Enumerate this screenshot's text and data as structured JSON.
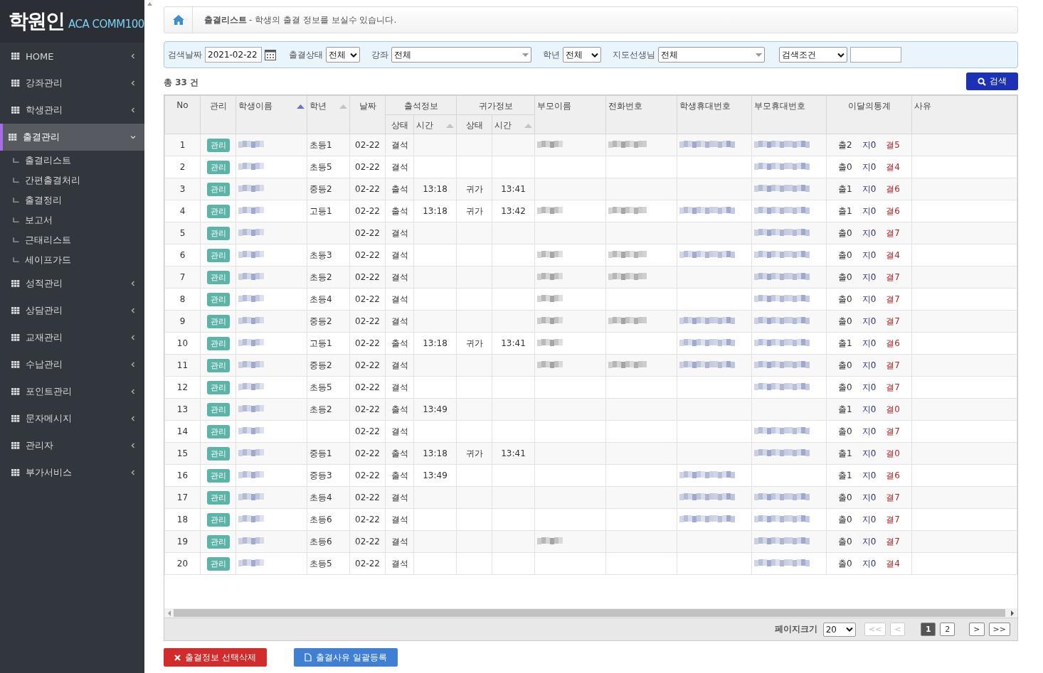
{
  "logo": {
    "mark": "학원인",
    "product": "ACA COMM100"
  },
  "sidebar": {
    "items": [
      {
        "label": "HOME",
        "expanded": false,
        "selected": false
      },
      {
        "label": "강좌관리",
        "expanded": false,
        "selected": false
      },
      {
        "label": "학생관리",
        "expanded": false,
        "selected": false
      },
      {
        "label": "출결관리",
        "expanded": true,
        "selected": true,
        "children": [
          {
            "marker": "ㄴ",
            "label": "출결리스트"
          },
          {
            "marker": "ㄴ",
            "label": "간편출결처리"
          },
          {
            "marker": "ㄴ",
            "label": "출결정리"
          },
          {
            "marker": "ㄴ",
            "label": "보고서"
          },
          {
            "marker": "ㄴ",
            "label": "근태리스트"
          },
          {
            "marker": "ㄴ",
            "label": "세이프가드"
          }
        ]
      },
      {
        "label": "성적관리",
        "expanded": false,
        "selected": false
      },
      {
        "label": "상담관리",
        "expanded": false,
        "selected": false
      },
      {
        "label": "교재관리",
        "expanded": false,
        "selected": false
      },
      {
        "label": "수납관리",
        "expanded": false,
        "selected": false
      },
      {
        "label": "포인트관리",
        "expanded": false,
        "selected": false
      },
      {
        "label": "문자메시지",
        "expanded": false,
        "selected": false
      },
      {
        "label": "관리자",
        "expanded": false,
        "selected": false
      },
      {
        "label": "부가서비스",
        "expanded": false,
        "selected": false
      }
    ]
  },
  "breadcrumb": {
    "title": "출결리스트",
    "description": "- 학생의 출결 정보를 보실수 있습니다."
  },
  "filters": {
    "date_label": "검색날짜",
    "date": "2021-02-22",
    "status_label": "출결상태",
    "status": "전체",
    "course_label": "강좌",
    "course": "전체",
    "grade_label": "학년",
    "grade": "전체",
    "teacher_label": "지도선생님",
    "teacher": "전체",
    "condition": "검색조건",
    "search_button": "검색"
  },
  "total": "총 33 건",
  "table": {
    "columns": [
      {
        "label": "No",
        "sortable": false
      },
      {
        "label": "관리",
        "sortable": false
      },
      {
        "label": "학생이름",
        "sortable": true,
        "sorted": true
      },
      {
        "label": "학년",
        "sortable": true,
        "sorted": false
      },
      {
        "label": "날짜",
        "sortable": false
      },
      {
        "label": "출석정보",
        "sub": [
          {
            "label": "상태",
            "sortable": false
          },
          {
            "label": "시간",
            "sortable": true,
            "sorted": false
          }
        ]
      },
      {
        "label": "귀가정보",
        "sub": [
          {
            "label": "상태",
            "sortable": false
          },
          {
            "label": "시간",
            "sortable": true,
            "sorted": false
          }
        ]
      },
      {
        "label": "부모이름",
        "sortable": false
      },
      {
        "label": "전화번호",
        "sortable": false
      },
      {
        "label": "학생휴대번호",
        "sortable": false
      },
      {
        "label": "부모휴대번호",
        "sortable": false
      },
      {
        "label": "이달의통계",
        "sortable": false
      },
      {
        "label": "사유",
        "sortable": false
      }
    ],
    "rows": [
      {
        "no": "1",
        "manage": "관리",
        "grade": "초등1",
        "date": "02-22",
        "status": "결석",
        "in_time": "",
        "home_status": "",
        "home_time": "",
        "blurred": {
          "name": true,
          "parent_name": true,
          "phone": true,
          "student_phone": true,
          "parent_phone": true
        },
        "stats": [
          "출2",
          "지0",
          "결5"
        ]
      },
      {
        "no": "2",
        "manage": "관리",
        "grade": "초등5",
        "date": "02-22",
        "status": "결석",
        "in_time": "",
        "home_status": "",
        "home_time": "",
        "blurred": {
          "name": true,
          "parent_name": false,
          "phone": false,
          "student_phone": false,
          "parent_phone": true
        },
        "stats": [
          "출0",
          "지0",
          "결4"
        ]
      },
      {
        "no": "3",
        "manage": "관리",
        "grade": "중등2",
        "date": "02-22",
        "status": "출석",
        "in_time": "13:18",
        "home_status": "귀가",
        "home_time": "13:41",
        "blurred": {
          "name": true,
          "parent_name": false,
          "phone": false,
          "student_phone": false,
          "parent_phone": true
        },
        "stats": [
          "출1",
          "지0",
          "결6"
        ]
      },
      {
        "no": "4",
        "manage": "관리",
        "grade": "고등1",
        "date": "02-22",
        "status": "출석",
        "in_time": "13:18",
        "home_status": "귀가",
        "home_time": "13:42",
        "blurred": {
          "name": true,
          "parent_name": true,
          "phone": true,
          "student_phone": true,
          "parent_phone": true
        },
        "stats": [
          "출1",
          "지0",
          "결6"
        ]
      },
      {
        "no": "5",
        "manage": "관리",
        "grade": "",
        "date": "02-22",
        "status": "결석",
        "in_time": "",
        "home_status": "",
        "home_time": "",
        "blurred": {
          "name": true,
          "parent_name": false,
          "phone": false,
          "student_phone": false,
          "parent_phone": true
        },
        "stats": [
          "출0",
          "지0",
          "결7"
        ]
      },
      {
        "no": "6",
        "manage": "관리",
        "grade": "초등3",
        "date": "02-22",
        "status": "결석",
        "in_time": "",
        "home_status": "",
        "home_time": "",
        "blurred": {
          "name": true,
          "parent_name": true,
          "phone": true,
          "student_phone": true,
          "parent_phone": true
        },
        "stats": [
          "출0",
          "지0",
          "결4"
        ]
      },
      {
        "no": "7",
        "manage": "관리",
        "grade": "초등2",
        "date": "02-22",
        "status": "결석",
        "in_time": "",
        "home_status": "",
        "home_time": "",
        "blurred": {
          "name": true,
          "parent_name": true,
          "phone": true,
          "student_phone": false,
          "parent_phone": true
        },
        "stats": [
          "출0",
          "지0",
          "결7"
        ]
      },
      {
        "no": "8",
        "manage": "관리",
        "grade": "초등4",
        "date": "02-22",
        "status": "결석",
        "in_time": "",
        "home_status": "",
        "home_time": "",
        "blurred": {
          "name": true,
          "parent_name": true,
          "phone": false,
          "student_phone": false,
          "parent_phone": true
        },
        "stats": [
          "출0",
          "지0",
          "결7"
        ]
      },
      {
        "no": "9",
        "manage": "관리",
        "grade": "중등2",
        "date": "02-22",
        "status": "결석",
        "in_time": "",
        "home_status": "",
        "home_time": "",
        "blurred": {
          "name": true,
          "parent_name": true,
          "phone": true,
          "student_phone": true,
          "parent_phone": true
        },
        "stats": [
          "출0",
          "지0",
          "결7"
        ]
      },
      {
        "no": "10",
        "manage": "관리",
        "grade": "고등1",
        "date": "02-22",
        "status": "출석",
        "in_time": "13:18",
        "home_status": "귀가",
        "home_time": "13:41",
        "blurred": {
          "name": true,
          "parent_name": true,
          "phone": false,
          "student_phone": true,
          "parent_phone": true
        },
        "stats": [
          "출1",
          "지0",
          "결6"
        ]
      },
      {
        "no": "11",
        "manage": "관리",
        "grade": "중등2",
        "date": "02-22",
        "status": "결석",
        "in_time": "",
        "home_status": "",
        "home_time": "",
        "blurred": {
          "name": true,
          "parent_name": true,
          "phone": true,
          "student_phone": true,
          "parent_phone": true
        },
        "stats": [
          "출0",
          "지0",
          "결7"
        ]
      },
      {
        "no": "12",
        "manage": "관리",
        "grade": "초등5",
        "date": "02-22",
        "status": "결석",
        "in_time": "",
        "home_status": "",
        "home_time": "",
        "blurred": {
          "name": true,
          "parent_name": false,
          "phone": false,
          "student_phone": false,
          "parent_phone": true
        },
        "stats": [
          "출0",
          "지0",
          "결7"
        ]
      },
      {
        "no": "13",
        "manage": "관리",
        "grade": "초등2",
        "date": "02-22",
        "status": "출석",
        "in_time": "13:49",
        "home_status": "",
        "home_time": "",
        "blurred": {
          "name": true,
          "parent_name": false,
          "phone": false,
          "student_phone": false,
          "parent_phone": false
        },
        "stats": [
          "출1",
          "지0",
          "결0"
        ]
      },
      {
        "no": "14",
        "manage": "관리",
        "grade": "",
        "date": "02-22",
        "status": "결석",
        "in_time": "",
        "home_status": "",
        "home_time": "",
        "blurred": {
          "name": true,
          "parent_name": false,
          "phone": false,
          "student_phone": false,
          "parent_phone": true
        },
        "stats": [
          "출0",
          "지0",
          "결7"
        ]
      },
      {
        "no": "15",
        "manage": "관리",
        "grade": "중등1",
        "date": "02-22",
        "status": "출석",
        "in_time": "13:18",
        "home_status": "귀가",
        "home_time": "13:41",
        "blurred": {
          "name": true,
          "parent_name": false,
          "phone": false,
          "student_phone": false,
          "parent_phone": true
        },
        "stats": [
          "출1",
          "지0",
          "결0"
        ]
      },
      {
        "no": "16",
        "manage": "관리",
        "grade": "중등3",
        "date": "02-22",
        "status": "출석",
        "in_time": "13:49",
        "home_status": "",
        "home_time": "",
        "blurred": {
          "name": true,
          "parent_name": false,
          "phone": false,
          "student_phone": true,
          "parent_phone": false
        },
        "stats": [
          "출1",
          "지0",
          "결6"
        ]
      },
      {
        "no": "17",
        "manage": "관리",
        "grade": "초등4",
        "date": "02-22",
        "status": "결석",
        "in_time": "",
        "home_status": "",
        "home_time": "",
        "blurred": {
          "name": true,
          "parent_name": false,
          "phone": false,
          "student_phone": true,
          "parent_phone": true
        },
        "stats": [
          "출0",
          "지0",
          "결7"
        ]
      },
      {
        "no": "18",
        "manage": "관리",
        "grade": "초등6",
        "date": "02-22",
        "status": "결석",
        "in_time": "",
        "home_status": "",
        "home_time": "",
        "blurred": {
          "name": true,
          "parent_name": false,
          "phone": false,
          "student_phone": true,
          "parent_phone": true
        },
        "stats": [
          "출0",
          "지0",
          "결7"
        ]
      },
      {
        "no": "19",
        "manage": "관리",
        "grade": "초등6",
        "date": "02-22",
        "status": "결석",
        "in_time": "",
        "home_status": "",
        "home_time": "",
        "blurred": {
          "name": true,
          "parent_name": true,
          "phone": false,
          "student_phone": false,
          "parent_phone": true
        },
        "stats": [
          "출0",
          "지0",
          "결7"
        ]
      },
      {
        "no": "20",
        "manage": "관리",
        "grade": "초등5",
        "date": "02-22",
        "status": "결석",
        "in_time": "",
        "home_status": "",
        "home_time": "",
        "blurred": {
          "name": true,
          "parent_name": false,
          "phone": false,
          "student_phone": false,
          "parent_phone": true
        },
        "stats": [
          "출0",
          "지0",
          "결4"
        ]
      }
    ]
  },
  "pager": {
    "size_label": "페이지크기",
    "size": "20",
    "first": {
      "label": "<<",
      "disabled": true
    },
    "prev": {
      "label": "<",
      "disabled": true
    },
    "pages": [
      {
        "label": "1",
        "selected": true
      },
      {
        "label": "2",
        "selected": false
      }
    ],
    "next": {
      "label": ">",
      "disabled": false
    },
    "last": {
      "label": ">>",
      "disabled": false
    }
  },
  "actions": [
    {
      "kind": "delete",
      "label": "출결정보 선택삭제"
    },
    {
      "kind": "register",
      "label": "출결사유 일괄등록"
    }
  ]
}
